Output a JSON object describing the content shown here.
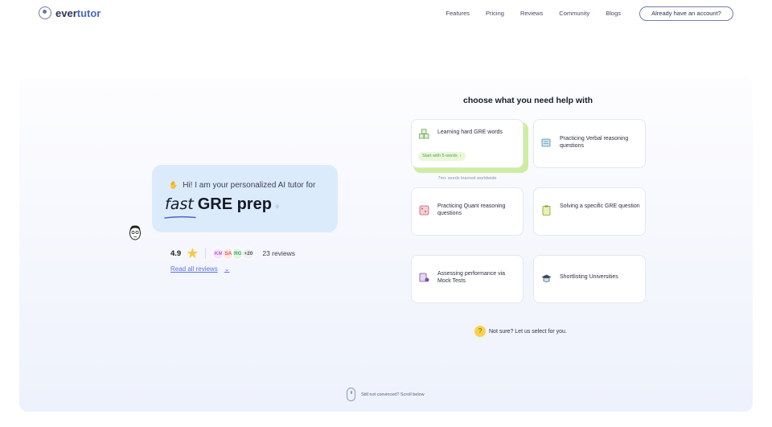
{
  "brand": {
    "prefix": "ever",
    "accent": "tutor"
  },
  "nav": {
    "links": [
      "Features",
      "Pricing",
      "Reviews",
      "Community",
      "Blogs"
    ],
    "account_button": "Already have an account?"
  },
  "hero": {
    "greeting": "Hi! I am your personalized AI tutor for",
    "headline_italic": "fast",
    "headline_bold": "GRE prep",
    "rating_value": "4.9",
    "reviewer_chips": [
      "KM",
      "SA",
      "RG",
      "+20"
    ],
    "reviews_count": "23 reviews",
    "read_all": "Read all reviews"
  },
  "options": {
    "title": "choose what you need help with",
    "cards": [
      {
        "label": "Learning hard GRE words",
        "icon": "blocks-icon",
        "cta": "Start with 5 words",
        "stat": "7m+ words learned worldwide"
      },
      {
        "label": "Practicing Verbal reasoning questions",
        "icon": "book-icon"
      },
      {
        "label": "Practicing Quant reasoning questions",
        "icon": "abacus-icon"
      },
      {
        "label": "Solving a specific GRE question",
        "icon": "clipboard-icon"
      },
      {
        "label": "Assessing performance via Mock Tests",
        "icon": "test-icon"
      },
      {
        "label": "Shortlisting Universities",
        "icon": "graduation-cap-icon"
      }
    ],
    "not_sure": "Not sure? Let us select for you."
  },
  "scroll_hint": "Still not convinced? Scroll below",
  "colors": {
    "accent": "#4a67c9",
    "bubble": "#dcebfb",
    "featured_shadow": "#cdeea0",
    "link": "#5a74d8"
  }
}
